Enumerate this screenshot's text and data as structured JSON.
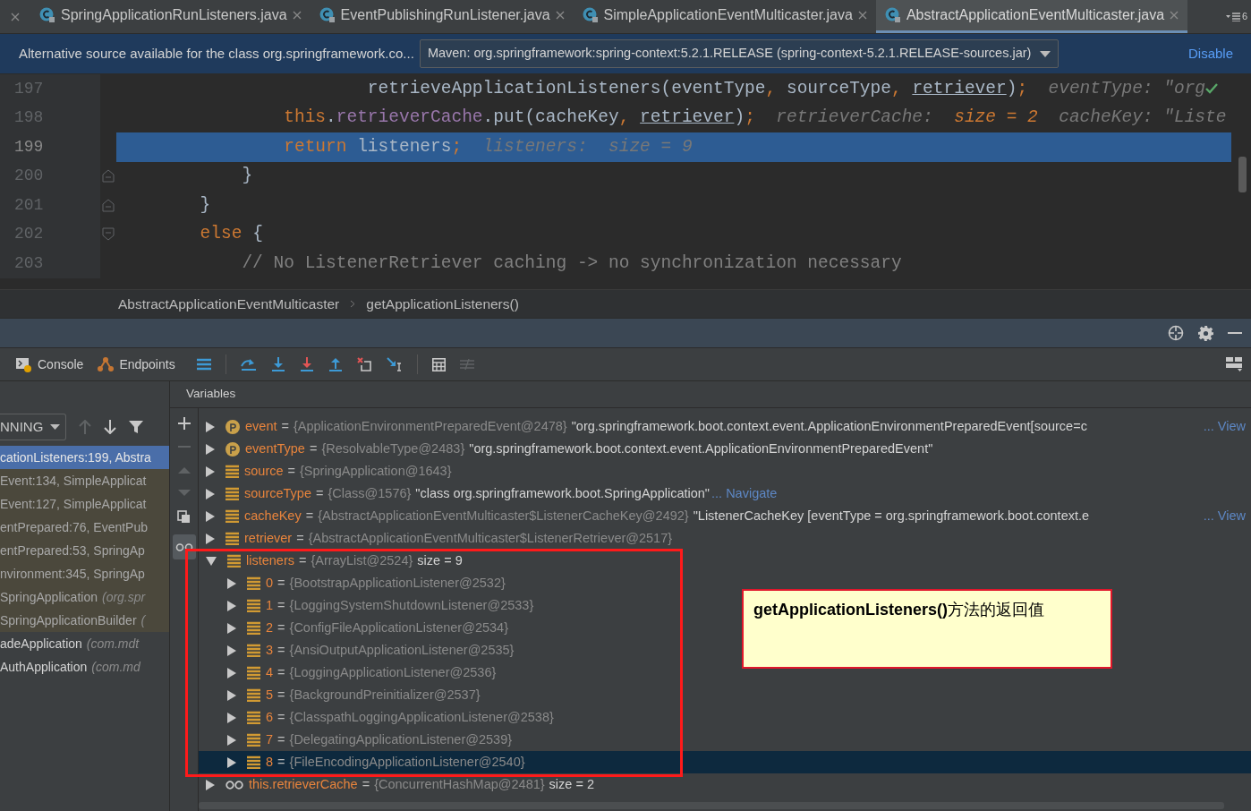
{
  "tabs": [
    {
      "label": "SpringApplicationRunListeners.java",
      "selected": false
    },
    {
      "label": "EventPublishingRunListener.java",
      "selected": false
    },
    {
      "label": "SimpleApplicationEventMulticaster.java",
      "selected": false
    },
    {
      "label": "AbstractApplicationEventMulticaster.java",
      "selected": true
    }
  ],
  "tab_overflow": "6",
  "banner": {
    "text": "Alternative source available for the class org.springframework.co...",
    "source": "Maven: org.springframework:spring-context:5.2.1.RELEASE (spring-context-5.2.1.RELEASE-sources.jar)",
    "action": "Disable"
  },
  "code_lines": [
    {
      "number": "197",
      "kind": "plain",
      "execution_point": false,
      "check": true,
      "segments": [
        {
          "kind": "plain",
          "text": "                        retrieveApplicationListeners(eventType"
        },
        {
          "kind": "punct",
          "text": ","
        },
        {
          "kind": "plain",
          "text": " sourceType"
        },
        {
          "kind": "punct",
          "text": ", "
        },
        {
          "kind": "underline",
          "text": "retriever"
        },
        {
          "kind": "plain",
          "text": ")"
        },
        {
          "kind": "punct",
          "text": ";"
        },
        {
          "kind": "hint",
          "text": "  eventType: \"org"
        }
      ]
    },
    {
      "number": "198",
      "kind": "plain",
      "execution_point": false,
      "segments": [
        {
          "kind": "keyword",
          "text": "                this"
        },
        {
          "kind": "plain",
          "text": "."
        },
        {
          "kind": "field",
          "text": "retrieverCache"
        },
        {
          "kind": "plain",
          "text": ".put(cacheKey"
        },
        {
          "kind": "punct",
          "text": ", "
        },
        {
          "kind": "underline",
          "text": "retriever"
        },
        {
          "kind": "plain",
          "text": ")"
        },
        {
          "kind": "punct",
          "text": ";"
        },
        {
          "kind": "hint",
          "text": "  retrieverCache:  "
        },
        {
          "kind": "hint_value",
          "text": "size = 2"
        },
        {
          "kind": "hint",
          "text": "  cacheKey: \"Liste"
        }
      ]
    },
    {
      "number": "199",
      "kind": "plain",
      "execution_point": true,
      "segments": [
        {
          "kind": "keyword",
          "text": "                return"
        },
        {
          "kind": "plain",
          "text": " listeners"
        },
        {
          "kind": "punct",
          "text": ";"
        },
        {
          "kind": "hint",
          "text": "  listeners:  size = 9"
        }
      ]
    },
    {
      "number": "200",
      "kind": "fold_end",
      "execution_point": false,
      "segments": [
        {
          "kind": "plain",
          "text": "            }"
        }
      ]
    },
    {
      "number": "201",
      "kind": "fold_end",
      "execution_point": false,
      "segments": [
        {
          "kind": "plain",
          "text": "        }"
        }
      ]
    },
    {
      "number": "202",
      "kind": "fold_start",
      "execution_point": false,
      "segments": [
        {
          "kind": "keyword",
          "text": "        else"
        },
        {
          "kind": "plain",
          "text": " {"
        }
      ]
    },
    {
      "number": "203",
      "kind": "plain",
      "execution_point": false,
      "segments": [
        {
          "kind": "comment",
          "text": "            // No ListenerRetriever caching -> no synchronization necessary"
        }
      ]
    }
  ],
  "breadcrumb": [
    "AbstractApplicationEventMulticaster",
    "getApplicationListeners()"
  ],
  "debug_tabs": [
    {
      "label": "Console",
      "kind": "console"
    },
    {
      "label": "Endpoints",
      "kind": "endpoints"
    }
  ],
  "thread_select": "NNING",
  "frames": [
    {
      "method": "cationListeners:199, Abstra",
      "kind": "library",
      "selected": true
    },
    {
      "method": "Event:134, SimpleApplicat",
      "kind": "library",
      "selected": false
    },
    {
      "method": "Event:127, SimpleApplicat",
      "kind": "library",
      "selected": false
    },
    {
      "method": "entPrepared:76, EventPub",
      "kind": "library",
      "selected": false
    },
    {
      "method": "entPrepared:53, SpringAp",
      "kind": "library",
      "selected": false
    },
    {
      "method": "nvironment:345, SpringAp",
      "kind": "library",
      "selected": false
    },
    {
      "method": "SpringApplication",
      "location": "(org.spr",
      "kind": "library",
      "selected": false
    },
    {
      "method": "SpringApplicationBuilder",
      "location": "(",
      "kind": "library",
      "selected": false
    },
    {
      "method": "adeApplication",
      "location": "(com.mdt",
      "kind": "user",
      "selected": false
    },
    {
      "method": "AuthApplication",
      "location": "(com.md",
      "kind": "user",
      "selected": false
    }
  ],
  "variables_title": "Variables",
  "variables": [
    {
      "kind": "param",
      "name": "event",
      "op": "=",
      "type": "{ApplicationEnvironmentPreparedEvent@2478}",
      "value": "\"org.springframework.boot.context.event.ApplicationEnvironmentPreparedEvent[source=c",
      "link": "... View",
      "expanded": false,
      "selected": false
    },
    {
      "kind": "param",
      "name": "eventType",
      "op": "=",
      "type": "{ResolvableType@2483}",
      "value": "\"org.springframework.boot.context.event.ApplicationEnvironmentPreparedEvent\"",
      "expanded": false,
      "selected": false
    },
    {
      "kind": "field",
      "name": "source",
      "op": "=",
      "type": "{SpringApplication@1643}",
      "expanded": false,
      "selected": false
    },
    {
      "kind": "field",
      "name": "sourceType",
      "op": "=",
      "type": "{Class@1576}",
      "value": "\"class org.springframework.boot.SpringApplication\"",
      "link": "... Navigate",
      "expanded": false,
      "selected": false
    },
    {
      "kind": "field",
      "name": "cacheKey",
      "op": "=",
      "type": "{AbstractApplicationEventMulticaster$ListenerCacheKey@2492}",
      "value": "\"ListenerCacheKey [eventType = org.springframework.boot.context.e",
      "link": "... View",
      "expanded": false,
      "selected": false
    },
    {
      "kind": "field",
      "name": "retriever",
      "op": "=",
      "type": "{AbstractApplicationEventMulticaster$ListenerRetriever@2517}",
      "expanded": false,
      "selected": false
    },
    {
      "kind": "field",
      "name": "listeners",
      "op": "=",
      "type": "{ArrayList@2524}",
      "value": "size = 9",
      "expanded": true,
      "selected": false,
      "children": [
        {
          "kind": "field",
          "name": "0",
          "op": "=",
          "type": "{BootstrapApplicationListener@2532}",
          "expanded": false,
          "selected": false
        },
        {
          "kind": "field",
          "name": "1",
          "op": "=",
          "type": "{LoggingSystemShutdownListener@2533}",
          "expanded": false,
          "selected": false
        },
        {
          "kind": "field",
          "name": "2",
          "op": "=",
          "type": "{ConfigFileApplicationListener@2534}",
          "expanded": false,
          "selected": false
        },
        {
          "kind": "field",
          "name": "3",
          "op": "=",
          "type": "{AnsiOutputApplicationListener@2535}",
          "expanded": false,
          "selected": false
        },
        {
          "kind": "field",
          "name": "4",
          "op": "=",
          "type": "{LoggingApplicationListener@2536}",
          "expanded": false,
          "selected": false
        },
        {
          "kind": "field",
          "name": "5",
          "op": "=",
          "type": "{BackgroundPreinitializer@2537}",
          "expanded": false,
          "selected": false
        },
        {
          "kind": "field",
          "name": "6",
          "op": "=",
          "type": "{ClasspathLoggingApplicationListener@2538}",
          "expanded": false,
          "selected": false
        },
        {
          "kind": "field",
          "name": "7",
          "op": "=",
          "type": "{DelegatingApplicationListener@2539}",
          "expanded": false,
          "selected": false
        },
        {
          "kind": "field",
          "name": "8",
          "op": "=",
          "type": "{FileEncodingApplicationListener@2540}",
          "expanded": false,
          "selected": true
        }
      ]
    },
    {
      "kind": "watch",
      "name": "this.retrieverCache",
      "op": "=",
      "type": "{ConcurrentHashMap@2481}",
      "value": "size = 2",
      "expanded": false,
      "selected": false
    }
  ],
  "callout": "**getApplicationListeners()**方法的返回值"
}
